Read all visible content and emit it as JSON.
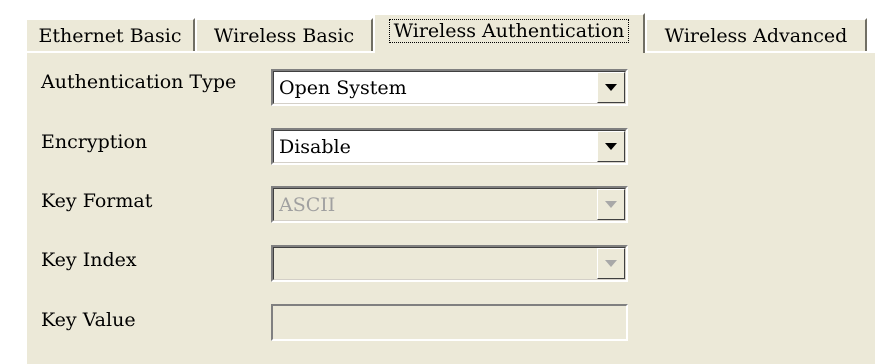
{
  "tabs": [
    {
      "label": "Ethernet Basic",
      "active": false
    },
    {
      "label": "Wireless Basic",
      "active": false
    },
    {
      "label": "Wireless Authentication",
      "active": true
    },
    {
      "label": "Wireless Advanced",
      "active": false
    }
  ],
  "form": {
    "authentication_type": {
      "label": "Authentication Type",
      "value": "Open System",
      "enabled": true
    },
    "encryption": {
      "label": "Encryption",
      "value": "Disable",
      "enabled": true
    },
    "key_format": {
      "label": "Key Format",
      "value": "ASCII",
      "enabled": false
    },
    "key_index": {
      "label": "Key Index",
      "value": "",
      "enabled": false
    },
    "key_value": {
      "label": "Key Value",
      "value": "",
      "enabled": false
    }
  },
  "colors": {
    "panel_bg": "#ece9d8",
    "disabled_text": "#a0a0a0"
  }
}
